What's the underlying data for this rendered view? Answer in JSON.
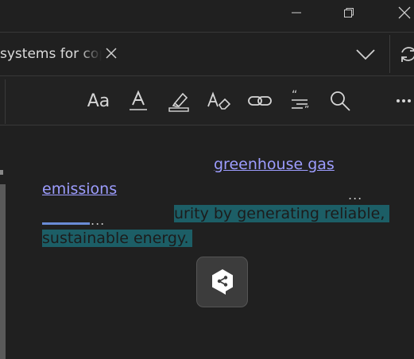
{
  "window": {
    "minimize_icon": "minimize-icon",
    "restore_icon": "restore-icon",
    "close_icon": "close-icon"
  },
  "tab": {
    "title": "systems for cop",
    "close_icon": "close-icon"
  },
  "tabbar": {
    "chevron_icon": "chevron-down-icon",
    "refresh_icon": "refresh-icon"
  },
  "toolbar": {
    "text_options_label": "Aa",
    "icons": [
      "text-size-icon",
      "font-color-icon",
      "highlight-icon",
      "clear-format-icon",
      "link-icon",
      "quote-icon",
      "search-icon",
      "more-icon"
    ]
  },
  "content": {
    "link_part1": "greenhouse gas ",
    "link_part2": "emissions",
    "highlight_line1": "urity by generating reliable,",
    "highlight_line2": "sustainable energy.",
    "dots": "...",
    "more_icon": "more-icon"
  },
  "overlay": {
    "deepl_icon": "deepl-logo-icon"
  },
  "colors": {
    "background": "#202020",
    "link": "#9d9dff",
    "highlight": "#1c5e66"
  }
}
